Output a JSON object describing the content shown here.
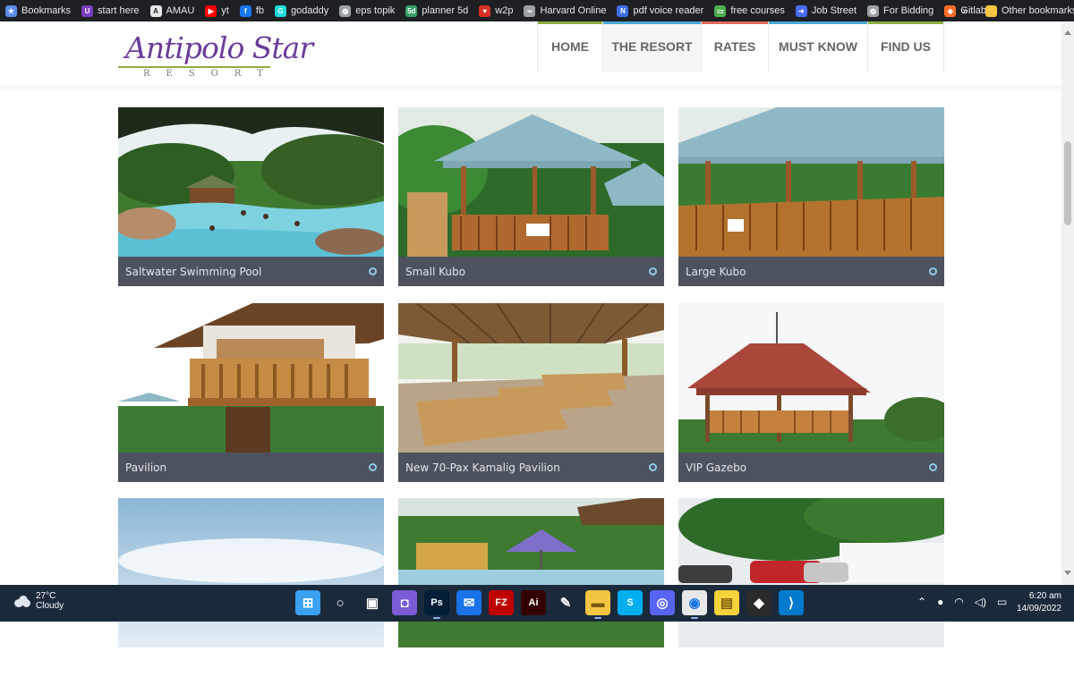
{
  "bookmarks": {
    "items": [
      {
        "label": "Bookmarks",
        "icon": "star-icon",
        "color": "#5b8def"
      },
      {
        "label": "start here",
        "icon": "start-icon",
        "color": "#7b3fc4"
      },
      {
        "label": "AMAU",
        "icon": "amau-icon",
        "color": "#e8e8e8"
      },
      {
        "label": "yt",
        "icon": "youtube-icon",
        "color": "#ff0000"
      },
      {
        "label": "fb",
        "icon": "facebook-icon",
        "color": "#1877f2"
      },
      {
        "label": "godaddy",
        "icon": "godaddy-icon",
        "color": "#1bdbdb"
      },
      {
        "label": "eps topik",
        "icon": "globe-icon",
        "color": "#9aa0a6"
      },
      {
        "label": "planner 5d",
        "icon": "planner-icon",
        "color": "#38a169"
      },
      {
        "label": "w2p",
        "icon": "heart-icon",
        "color": "#d93025"
      },
      {
        "label": "Harvard Online",
        "icon": "harvard-icon",
        "color": "#9aa0a6"
      },
      {
        "label": "pdf voice reader",
        "icon": "pdf-reader-icon",
        "color": "#3d6ee8"
      },
      {
        "label": "free courses",
        "icon": "courses-icon",
        "color": "#4caf50"
      },
      {
        "label": "Job Street",
        "icon": "jobstreet-icon",
        "color": "#4a6cf7"
      },
      {
        "label": "For Bidding",
        "icon": "globe-icon",
        "color": "#9aa0a6"
      },
      {
        "label": "Gitlab",
        "icon": "gitlab-icon",
        "color": "#fc6d26"
      }
    ],
    "more": "»",
    "other": "Other bookmarks"
  },
  "site": {
    "logo_main": "Antipolo Star",
    "logo_sub": "RESORT",
    "nav": [
      {
        "label": "HOME",
        "color": "#8dae3c",
        "active": false
      },
      {
        "label": "THE RESORT",
        "color": "#4aa8d8",
        "active": true
      },
      {
        "label": "RATES",
        "color": "#e06b5a",
        "active": false
      },
      {
        "label": "MUST KNOW",
        "color": "#4aa8d8",
        "active": false
      },
      {
        "label": "FIND US",
        "color": "#8dae3c",
        "active": false
      }
    ]
  },
  "gallery": {
    "cards": [
      {
        "title": "Saltwater Swimming Pool",
        "scene": "pool"
      },
      {
        "title": "Small Kubo",
        "scene": "kubo"
      },
      {
        "title": "Large Kubo",
        "scene": "large-kubo"
      },
      {
        "title": "Pavilion",
        "scene": "pavilion"
      },
      {
        "title": "New 70-Pax Kamalig Pavilion",
        "scene": "kamalig"
      },
      {
        "title": "VIP Gazebo",
        "scene": "gazebo"
      },
      {
        "title": "",
        "scene": "sky"
      },
      {
        "title": "",
        "scene": "playground"
      },
      {
        "title": "",
        "scene": "parking"
      }
    ]
  },
  "taskbar": {
    "weather_temp": "27°C",
    "weather_desc": "Cloudy",
    "apps": [
      {
        "label": "",
        "icon": "windows-start-icon",
        "color": "#3aa0f0",
        "running": false
      },
      {
        "label": "",
        "icon": "search-icon",
        "color": "transparent",
        "running": false
      },
      {
        "label": "",
        "icon": "task-view-icon",
        "color": "transparent",
        "running": false
      },
      {
        "label": "",
        "icon": "chat-icon",
        "color": "#7b5cd6",
        "running": false
      },
      {
        "label": "Ps",
        "icon": "photoshop-icon",
        "color": "#001e36",
        "running": true
      },
      {
        "label": "",
        "icon": "mail-icon",
        "color": "#1a73e8",
        "running": false
      },
      {
        "label": "FZ",
        "icon": "filezilla-icon",
        "color": "#bf0000",
        "running": false
      },
      {
        "label": "Ai",
        "icon": "illustrator-icon",
        "color": "#330000",
        "running": false
      },
      {
        "label": "",
        "icon": "pencil-icon",
        "color": "transparent",
        "running": false
      },
      {
        "label": "",
        "icon": "file-explorer-icon",
        "color": "#f4c542",
        "running": true
      },
      {
        "label": "S",
        "icon": "skype-icon",
        "color": "#00aff0",
        "running": false
      },
      {
        "label": "",
        "icon": "discord-icon",
        "color": "#5865f2",
        "running": false
      },
      {
        "label": "",
        "icon": "chrome-icon",
        "color": "#e8e8e8",
        "running": true
      },
      {
        "label": "",
        "icon": "sticky-notes-icon",
        "color": "#f6d23b",
        "running": false
      },
      {
        "label": "",
        "icon": "git-icon",
        "color": "#2b2b2b",
        "running": false
      },
      {
        "label": "",
        "icon": "vscode-icon",
        "color": "#007acc",
        "running": false
      }
    ],
    "time": "6:20 am",
    "date": "14/09/2022"
  }
}
